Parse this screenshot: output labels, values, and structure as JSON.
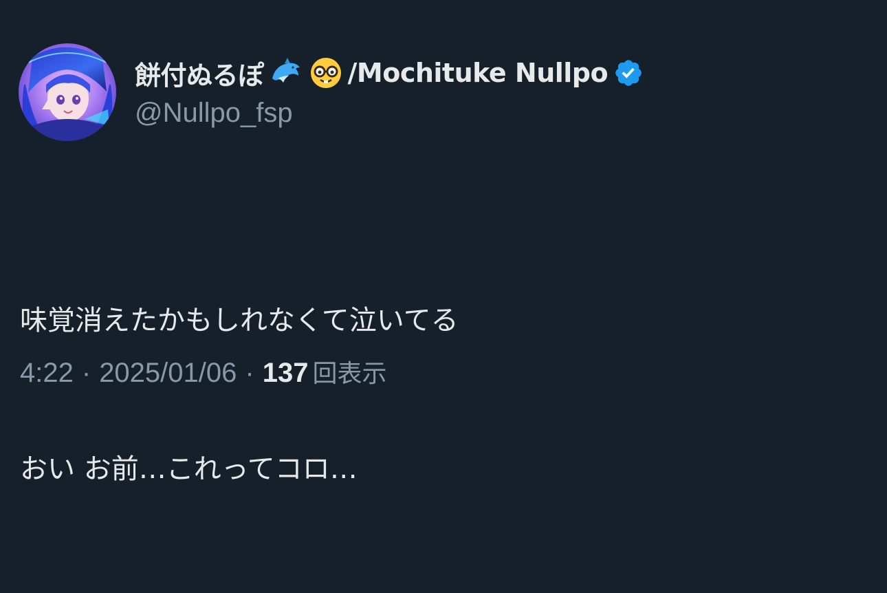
{
  "user": {
    "display_name": "餅付ぬるぽ",
    "emojis": [
      "dolphin-emoji",
      "nerd-face-emoji"
    ],
    "display_name_tail": "/Mochituke Nullpo",
    "handle": "@Nullpo_fsp",
    "verified": true,
    "avatar_icon": "anime-avatar",
    "verified_icon": "verified-badge-icon"
  },
  "tweet": {
    "lines": [
      "味覚消えたかもしれなくて泣いてる",
      "おい お前…これってコロ…"
    ]
  },
  "meta": {
    "time": "4:22",
    "separator": "·",
    "date": "2025/01/06",
    "views_count": "137",
    "views_label": "回表示"
  },
  "colors": {
    "background": "#15202b",
    "primary_text": "#e7e9ea",
    "secondary_text": "#8b98a5",
    "verified": "#1d9bf0"
  }
}
